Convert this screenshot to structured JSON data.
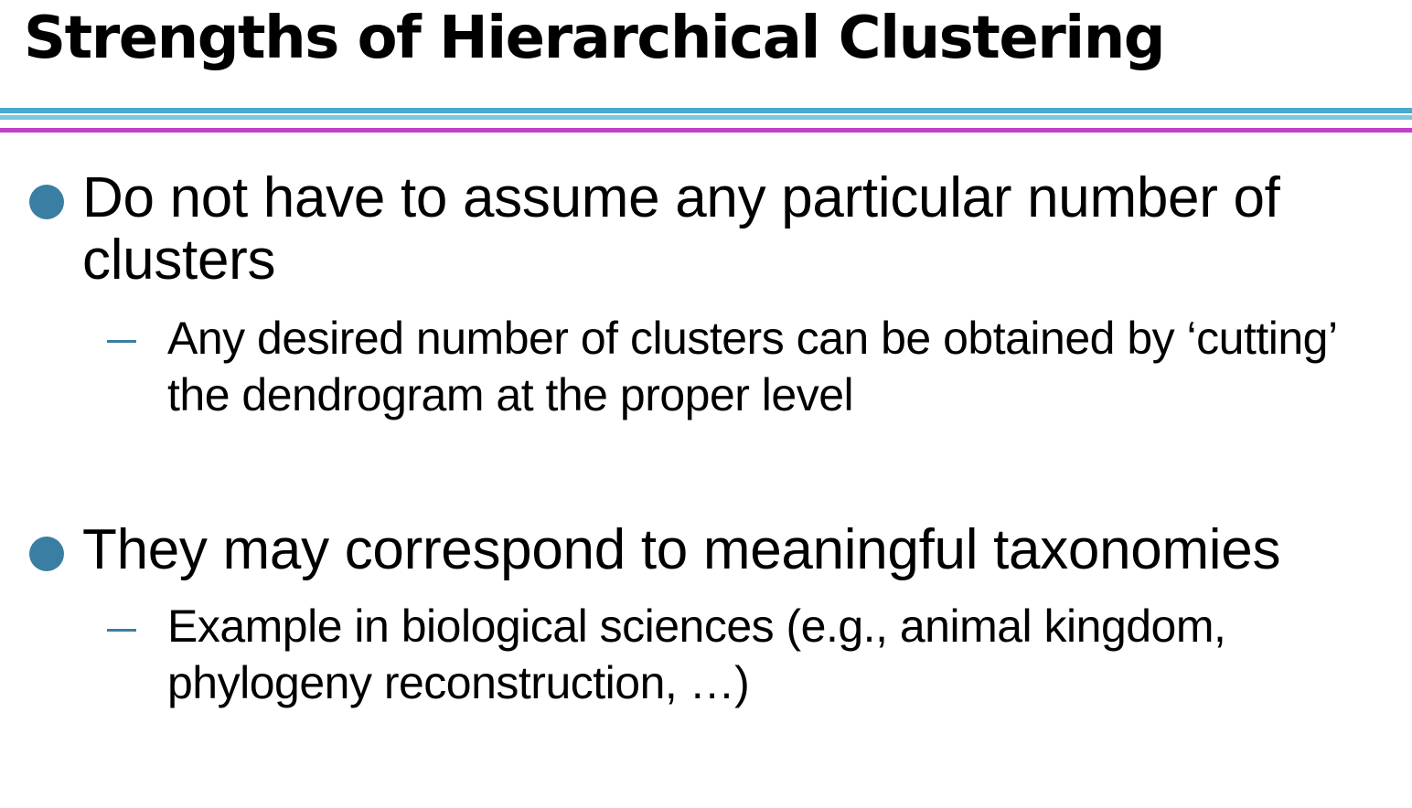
{
  "title": "Strengths of Hierarchical Clustering",
  "colors": {
    "bullet": "#3a7fa3",
    "dash": "#3a7fa3",
    "rule_blue": "#49a9cf",
    "rule_magenta": "#c03ec8"
  },
  "bullets": [
    {
      "text": "Do not have to assume any particular number of clusters",
      "sub": "Any desired number of clusters can be obtained by ‘cutting’ the dendrogram at the proper level"
    },
    {
      "text": "They may correspond to meaningful taxonomies",
      "sub": "Example in biological sciences (e.g., animal kingdom, phylogeny reconstruction, …)"
    }
  ]
}
